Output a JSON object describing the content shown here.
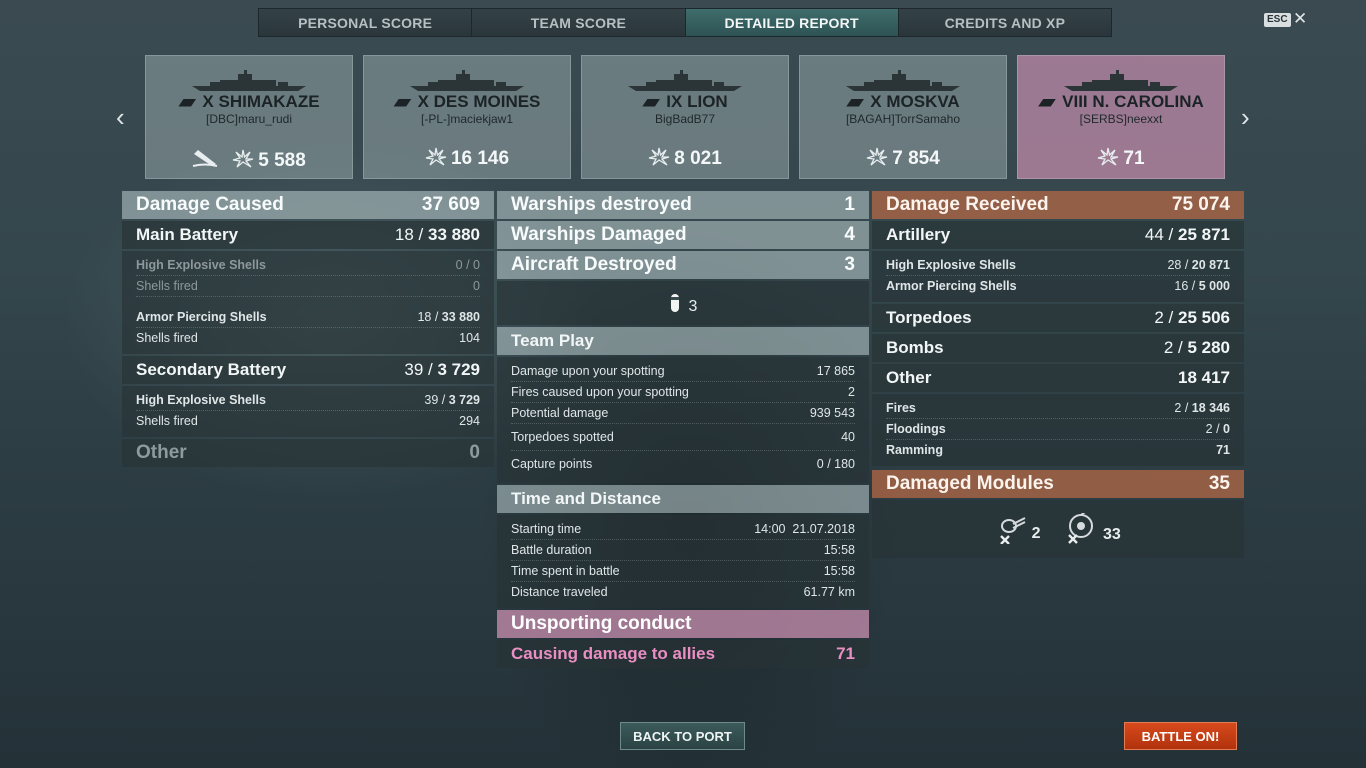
{
  "tabs": [
    {
      "label": "PERSONAL SCORE",
      "active": false
    },
    {
      "label": "TEAM SCORE",
      "active": false
    },
    {
      "label": "DETAILED REPORT",
      "active": true
    },
    {
      "label": "CREDITS AND XP",
      "active": false
    }
  ],
  "esc_label": "ESC",
  "close_glyph": "✕",
  "nav": {
    "prev": "‹",
    "next": "›"
  },
  "ships": [
    {
      "tier": "X",
      "name": "SHIMAKAZE",
      "player": "[DBC]maru_rudi",
      "damage": "5 588",
      "sunk_icon": "sunk-ship-icon"
    },
    {
      "tier": "X",
      "name": "DES MOINES",
      "player": "[-PL-]maciekjaw1",
      "damage": "16 146"
    },
    {
      "tier": "IX",
      "name": "LION",
      "player": "BigBadB77",
      "damage": "8 021"
    },
    {
      "tier": "X",
      "name": "MOSKVA",
      "player": "[BAGAH]TorrSamaho",
      "damage": "7 854"
    },
    {
      "tier": "VIII",
      "name": "N. CAROLINA",
      "player": "[SERBS]neexxt",
      "damage": "71",
      "own": true
    }
  ],
  "left": {
    "damage_caused": {
      "label": "Damage Caused",
      "value": "37 609"
    },
    "main_battery": {
      "label": "Main Battery",
      "hits": "18",
      "dmg": "33 880"
    },
    "mb_he": {
      "label": "High Explosive Shells",
      "value": "0 / 0"
    },
    "mb_he_fired": {
      "label": "Shells fired",
      "value": "0"
    },
    "mb_ap": {
      "label": "Armor Piercing Shells",
      "hits": "18",
      "dmg": "33 880"
    },
    "mb_ap_fired": {
      "label": "Shells fired",
      "value": "104"
    },
    "secondary": {
      "label": "Secondary Battery",
      "hits": "39",
      "dmg": "3 729"
    },
    "sec_he": {
      "label": "High Explosive Shells",
      "hits": "39",
      "dmg": "3 729"
    },
    "sec_he_fired": {
      "label": "Shells fired",
      "value": "294"
    },
    "other": {
      "label": "Other",
      "value": "0"
    }
  },
  "middle": {
    "warships_destroyed": {
      "label": "Warships destroyed",
      "value": "1"
    },
    "warships_damaged": {
      "label": "Warships Damaged",
      "value": "4"
    },
    "aircraft_destroyed": {
      "label": "Aircraft Destroyed",
      "value": "3"
    },
    "aircraft_icon_count": "3",
    "team_play": {
      "label": "Team Play",
      "rows": [
        {
          "label": "Damage upon your spotting",
          "value": "17 865"
        },
        {
          "label": "Fires caused upon your spotting",
          "value": "2"
        },
        {
          "label": "Potential damage",
          "value": "939 543"
        },
        {
          "label": "Torpedoes spotted",
          "value": "40"
        },
        {
          "label": "Capture points",
          "value": "0 / 180"
        }
      ]
    },
    "time_distance": {
      "label": "Time and Distance",
      "rows": [
        {
          "label": "Starting time",
          "value": "14:00  21.07.2018"
        },
        {
          "label": "Battle duration",
          "value": "15:58"
        },
        {
          "label": "Time spent in battle",
          "value": "15:58"
        },
        {
          "label": "Distance traveled",
          "value": "61.77 km"
        }
      ]
    },
    "unsporting": {
      "label": "Unsporting conduct",
      "row_label": "Causing damage to allies",
      "row_value": "71"
    }
  },
  "right": {
    "damage_received": {
      "label": "Damage Received",
      "value": "75 074"
    },
    "artillery": {
      "label": "Artillery",
      "hits": "44",
      "dmg": "25 871"
    },
    "art_he": {
      "label": "High Explosive Shells",
      "hits": "28",
      "dmg": "20 871"
    },
    "art_ap": {
      "label": "Armor Piercing Shells",
      "hits": "16",
      "dmg": "5 000"
    },
    "torpedoes": {
      "label": "Torpedoes",
      "hits": "2",
      "dmg": "25 506"
    },
    "bombs": {
      "label": "Bombs",
      "hits": "2",
      "dmg": "5 280"
    },
    "other": {
      "label": "Other",
      "value": "18 417"
    },
    "fires": {
      "label": "Fires",
      "hits": "2",
      "dmg": "18 346"
    },
    "floodings": {
      "label": "Floodings",
      "hits": "2",
      "dmg": "0"
    },
    "ramming": {
      "label": "Ramming",
      "value": "71"
    },
    "damaged_modules": {
      "label": "Damaged Modules",
      "value": "35"
    },
    "modules": [
      {
        "icon": "turret-destroyed-icon",
        "count": "2"
      },
      {
        "icon": "aa-gun-destroyed-icon",
        "count": "33"
      }
    ]
  },
  "buttons": {
    "back_to_port": "BACK TO PORT",
    "battle_on": "BATTLE ON!"
  }
}
